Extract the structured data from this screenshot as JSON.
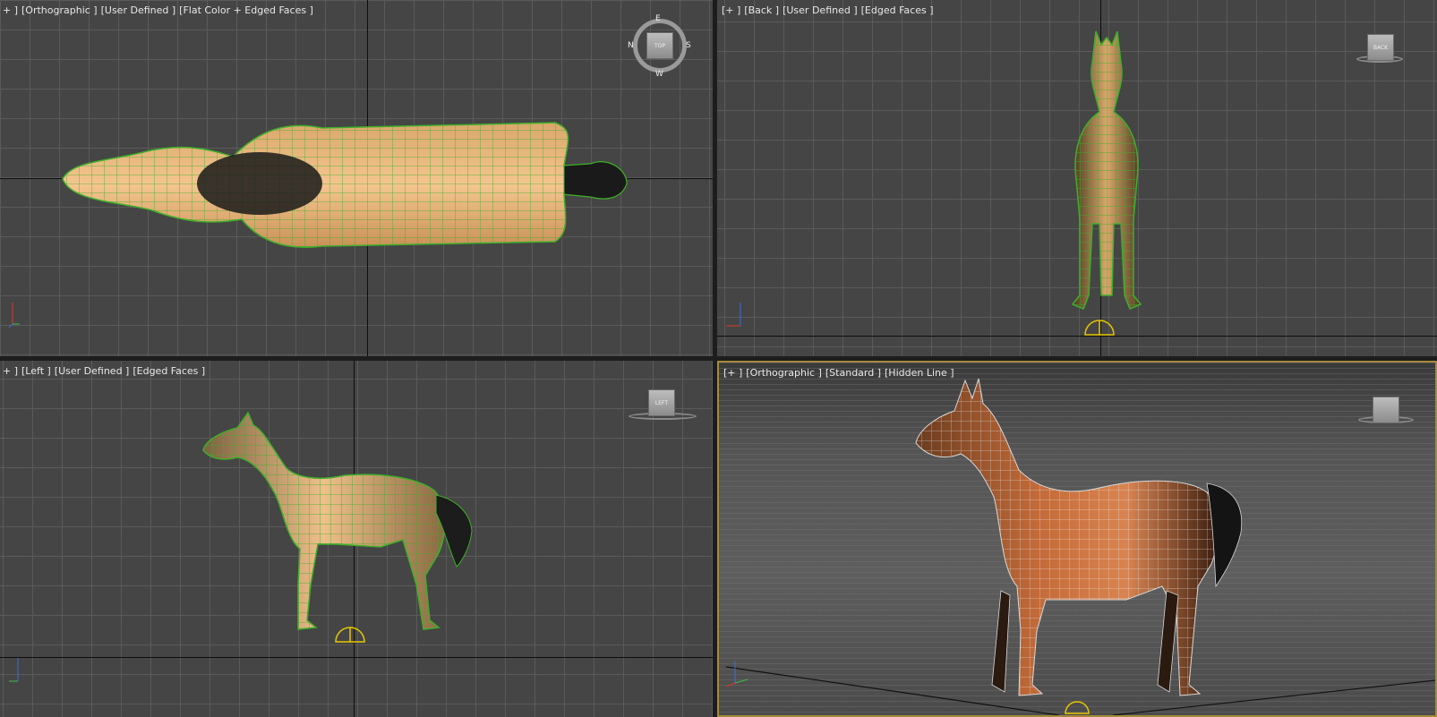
{
  "viewports": {
    "top": {
      "label": [
        "+ ]",
        "[Orthographic ]",
        "[User Defined ]",
        "[Flat Color + Edged Faces ]"
      ],
      "compass": {
        "n": "N",
        "s": "S",
        "e": "E",
        "w": "W"
      },
      "viewcube_label": "TOP"
    },
    "back": {
      "label": [
        "[+ ]",
        "[Back ]",
        "[User Defined ]",
        "[Edged Faces ]"
      ],
      "viewcube_label": "BACK"
    },
    "left": {
      "label": [
        "+ ]",
        "[Left ]",
        "[User Defined ]",
        "[Edged Faces ]"
      ],
      "viewcube_label": "LEFT"
    },
    "perspective": {
      "label": [
        "[+ ]",
        "[Orthographic ]",
        "[Standard ]",
        "[Hidden Line ]"
      ],
      "viewcube_label": ""
    }
  },
  "axes": {
    "x": "x",
    "y": "y",
    "z": "z"
  },
  "colors": {
    "viewport_bg": "#454545",
    "grid": "#5a5a5a",
    "wire_green": "#3fae2a",
    "active_border": "#a68a3a",
    "pivot": "#e6c700",
    "axis_x": "#d23a2a",
    "axis_y": "#3fbf3f",
    "axis_z": "#3a6fd8"
  }
}
